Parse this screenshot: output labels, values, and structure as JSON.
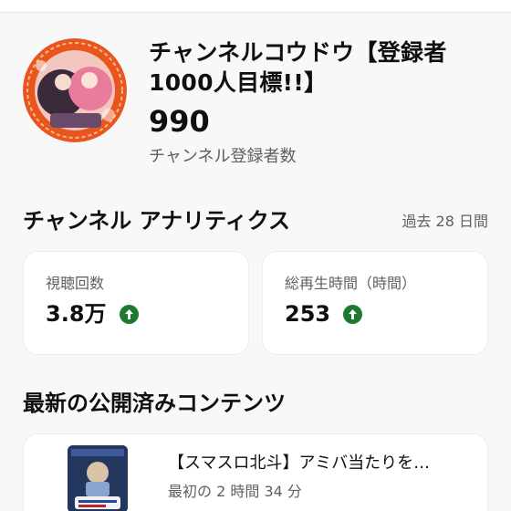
{
  "channel": {
    "name": "チャンネルコウドウ【登録者1000人目標!!】",
    "subscriber_count": "990",
    "subscriber_label": "チャンネル登録者数"
  },
  "analytics": {
    "title": "チャンネル アナリティクス",
    "period": "過去 28 日間",
    "metrics": [
      {
        "label": "視聴回数",
        "value": "3.8万",
        "trend": "up"
      },
      {
        "label": "総再生時間（時間）",
        "value": "253",
        "trend": "up"
      }
    ]
  },
  "latest": {
    "title": "最新の公開済みコンテンツ",
    "video": {
      "title": "【スマスロ北斗】アミバ当たりを…",
      "meta": "最初の 2 時間 34 分"
    }
  },
  "colors": {
    "trend_up": "#1e7a2e",
    "avatar_ring": "#e8551e"
  }
}
